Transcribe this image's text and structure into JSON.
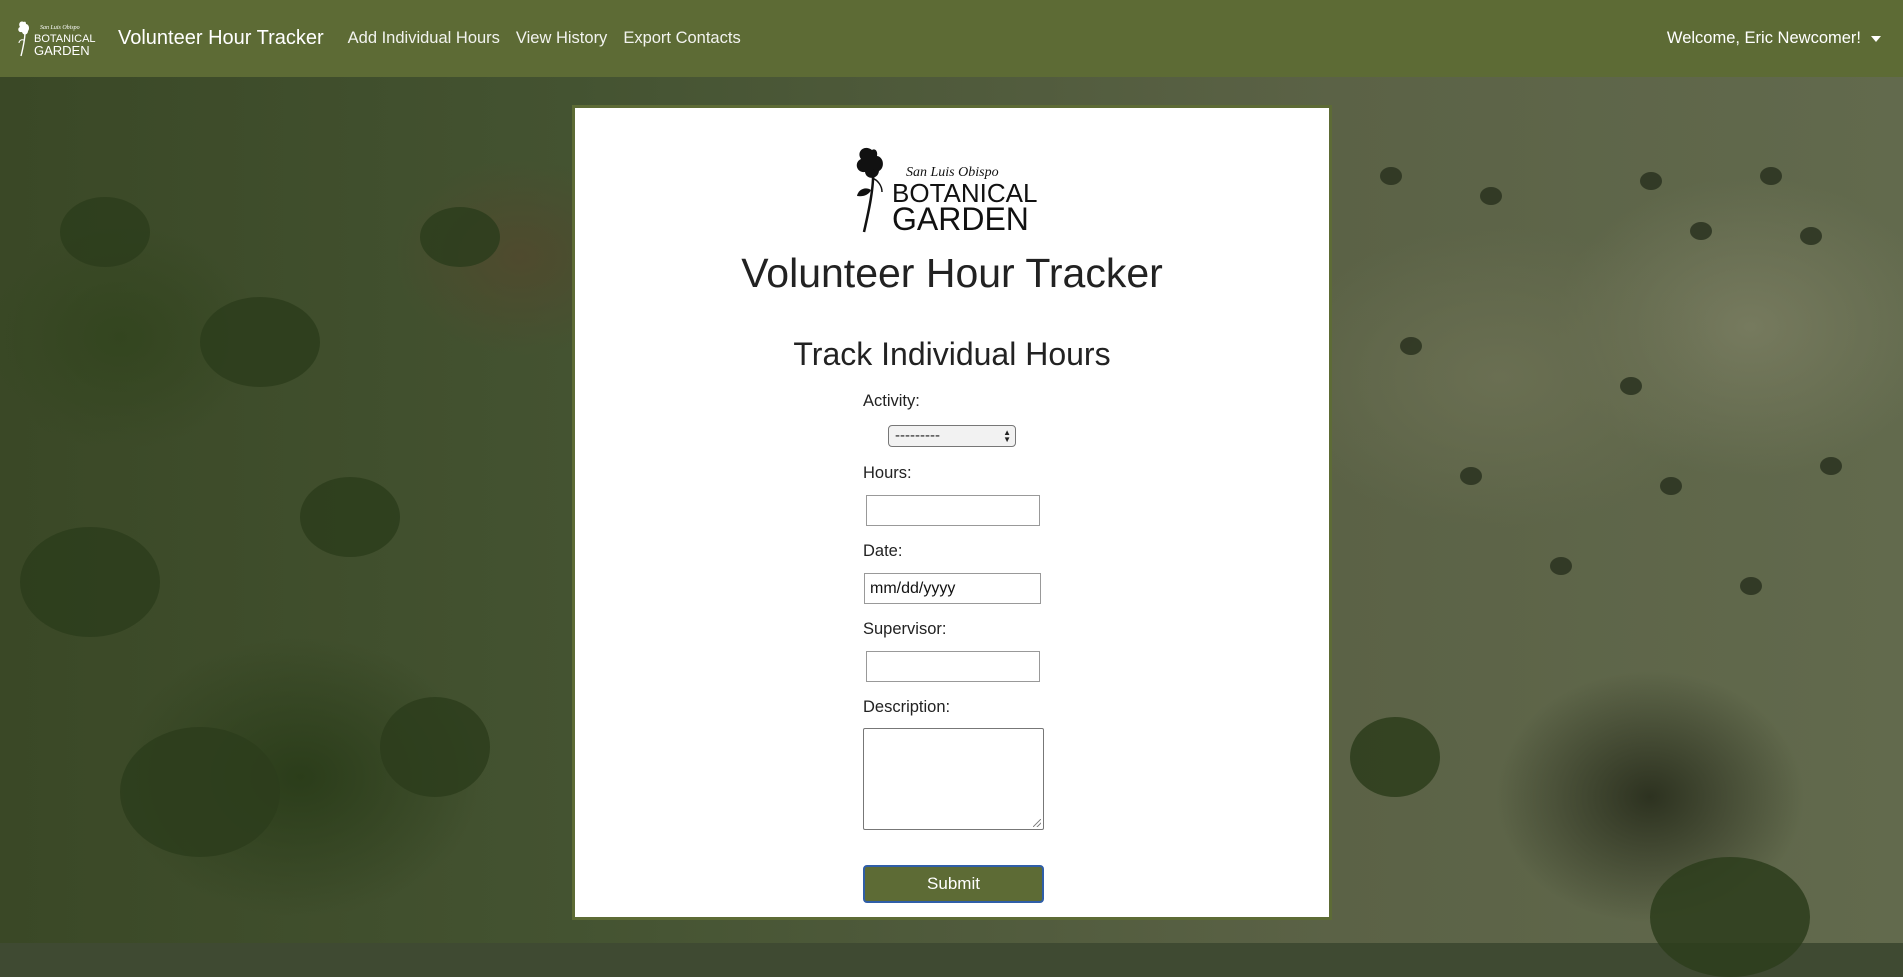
{
  "navbar": {
    "brand": "Volunteer Hour Tracker",
    "logo": {
      "line1": "San Luis Obispo",
      "line2": "BOTANICAL",
      "line3": "GARDEN"
    },
    "links": [
      "Add Individual Hours",
      "View History",
      "Export Contacts"
    ],
    "user_menu": "Welcome, Eric Newcomer!"
  },
  "card": {
    "logo": {
      "line1": "San Luis Obispo",
      "line2": "BOTANICAL",
      "line3": "GARDEN"
    },
    "title": "Volunteer Hour Tracker",
    "form_title": "Track Individual Hours"
  },
  "form": {
    "activity_label": "Activity:",
    "activity_selected": "---------",
    "hours_label": "Hours:",
    "hours_value": "",
    "date_label": "Date:",
    "date_value": "mm/dd/yyyy",
    "supervisor_label": "Supervisor:",
    "supervisor_value": "",
    "description_label": "Description:",
    "description_value": "",
    "submit_label": "Submit"
  },
  "colors": {
    "navbar_bg": "#5d6b35",
    "button_bg": "#5d6b35",
    "card_border": "#5d6b35"
  }
}
